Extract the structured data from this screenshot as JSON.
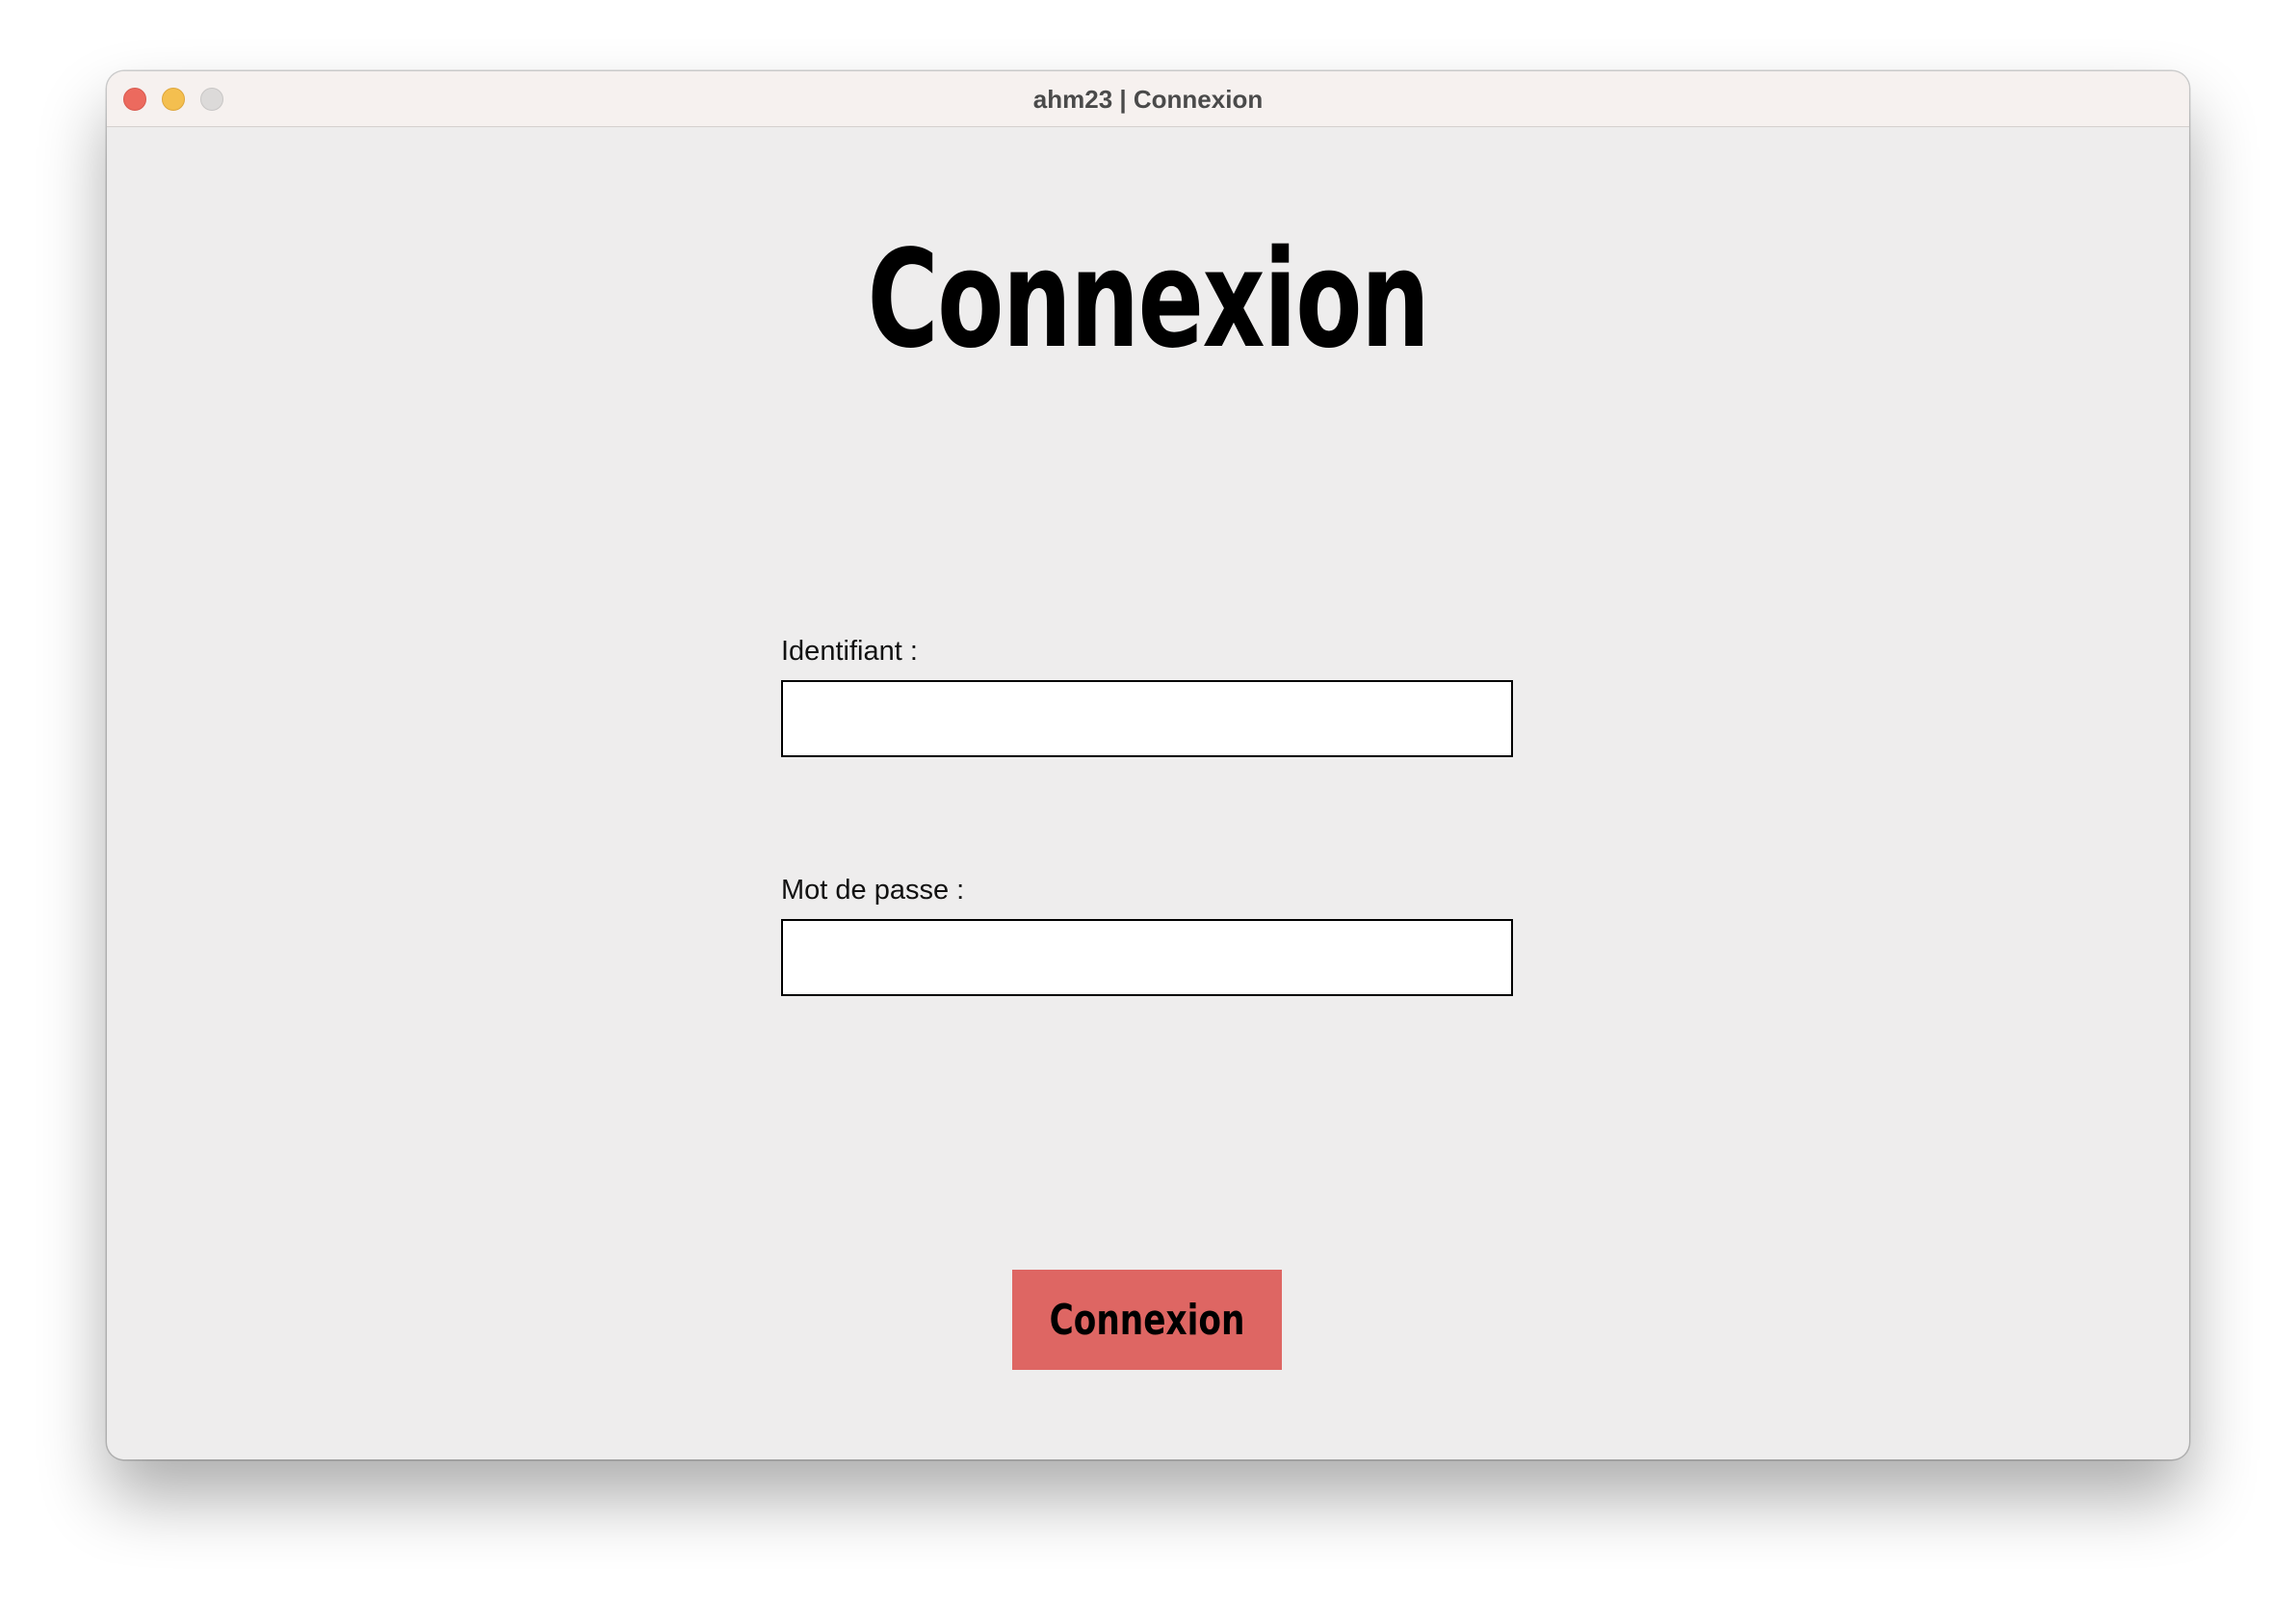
{
  "window": {
    "title": "ahm23 | Connexion"
  },
  "page": {
    "heading": "Connexion"
  },
  "form": {
    "username": {
      "label": "Identifiant :",
      "value": ""
    },
    "password": {
      "label": "Mot de passe :",
      "value": ""
    },
    "submit_label": "Connexion"
  },
  "colors": {
    "submit_button": "#de6663",
    "window_background": "#eeeded",
    "titlebar_background": "#f6f1ef"
  },
  "icons": {
    "close": "close-traffic-light-icon",
    "minimize": "minimize-traffic-light-icon",
    "zoom": "zoom-traffic-light-icon"
  }
}
